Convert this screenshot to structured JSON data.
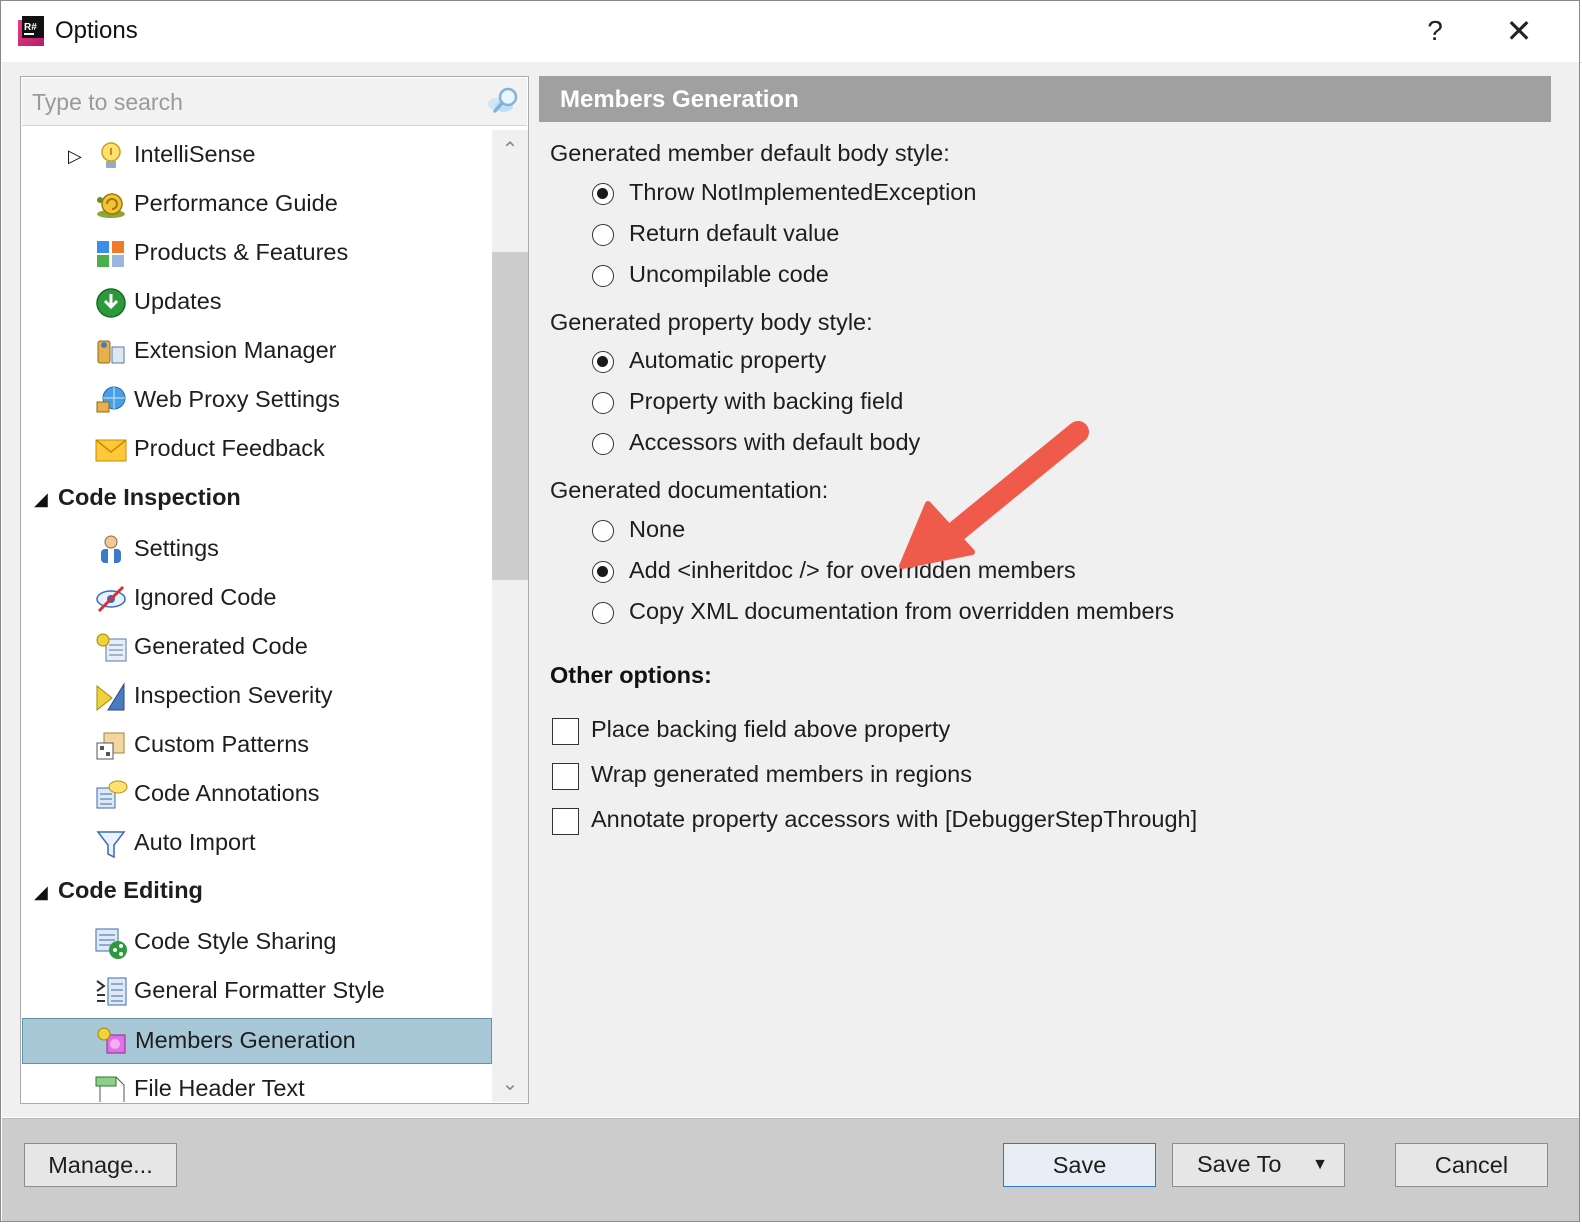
{
  "window": {
    "title": "Options",
    "help_label": "?",
    "close_label": "✕",
    "app_icon": "resharper-icon",
    "app_icon_text": "R#"
  },
  "search": {
    "placeholder": "Type to search",
    "icon": "search-icon"
  },
  "tree": {
    "items": [
      {
        "label": "IntelliSense",
        "icon": "lightbulb-icon",
        "level": 1,
        "expander": "▷"
      },
      {
        "label": "Performance Guide",
        "icon": "snail-icon",
        "level": 1
      },
      {
        "label": "Products & Features",
        "icon": "blocks-icon",
        "level": 1
      },
      {
        "label": "Updates",
        "icon": "download-icon",
        "level": 1
      },
      {
        "label": "Extension Manager",
        "icon": "extension-icon",
        "level": 1
      },
      {
        "label": "Web Proxy Settings",
        "icon": "globe-plug-icon",
        "level": 1
      },
      {
        "label": "Product Feedback",
        "icon": "envelope-icon",
        "level": 1
      },
      {
        "label": "Code Inspection",
        "level": 0,
        "expander": "◢",
        "bold": true
      },
      {
        "label": "Settings",
        "icon": "user-settings-icon",
        "level": 1
      },
      {
        "label": "Ignored Code",
        "icon": "eye-slash-icon",
        "level": 1
      },
      {
        "label": "Generated Code",
        "icon": "generated-code-icon",
        "level": 1
      },
      {
        "label": "Inspection Severity",
        "icon": "severity-icon",
        "level": 1
      },
      {
        "label": "Custom Patterns",
        "icon": "patterns-icon",
        "level": 1
      },
      {
        "label": "Code Annotations",
        "icon": "annotation-icon",
        "level": 1
      },
      {
        "label": "Auto Import",
        "icon": "funnel-icon",
        "level": 1
      },
      {
        "label": "Code Editing",
        "level": 0,
        "expander": "◢",
        "bold": true
      },
      {
        "label": "Code Style Sharing",
        "icon": "share-icon",
        "level": 1
      },
      {
        "label": "General Formatter Style",
        "icon": "formatter-icon",
        "level": 1
      },
      {
        "label": "Members Generation",
        "icon": "members-icon",
        "level": 1,
        "selected": true
      },
      {
        "label": "File Header Text",
        "icon": "file-header-icon",
        "level": 1
      }
    ]
  },
  "scrollbar": {
    "up": "⌃",
    "down": "⌄"
  },
  "panel": {
    "title": "Members Generation",
    "body_style": {
      "label": "Generated member default body style:",
      "options": [
        "Throw NotImplementedException",
        "Return default value",
        "Uncompilable code"
      ],
      "selected": 0
    },
    "property_style": {
      "label": "Generated property body style:",
      "options": [
        "Automatic property",
        "Property with backing field",
        "Accessors with default body"
      ],
      "selected": 0
    },
    "documentation": {
      "label": "Generated documentation:",
      "options": [
        "None",
        "Add <inheritdoc /> for overridden members",
        "Copy XML documentation from overridden members"
      ],
      "selected": 1
    },
    "other": {
      "label": "Other options:",
      "checkboxes": [
        {
          "label": "Place backing field above property",
          "checked": false
        },
        {
          "label": "Wrap generated members in regions",
          "checked": false
        },
        {
          "label": "Annotate property accessors with [DebuggerStepThrough]",
          "checked": false
        }
      ]
    }
  },
  "footer": {
    "manage_label": "Manage...",
    "save_label": "Save",
    "save_to_label": "Save To",
    "save_to_arrow": "▼",
    "cancel_label": "Cancel"
  },
  "colors": {
    "selection_bg": "#a8c8d8",
    "header_bg": "#a0a0a0",
    "arrow": "#ef5a4a",
    "primary_border": "#2b78d4"
  }
}
